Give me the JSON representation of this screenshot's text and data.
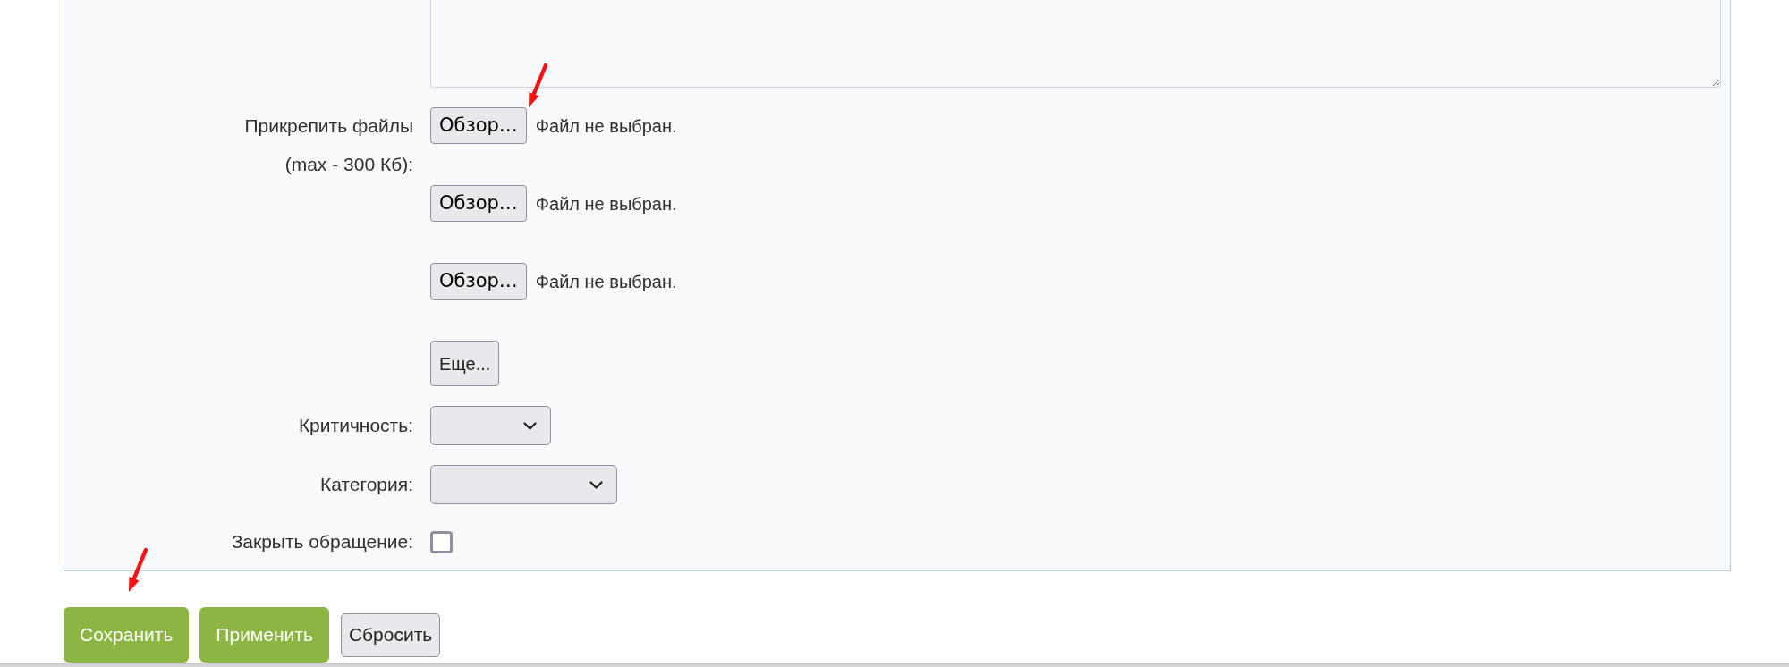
{
  "attachments": {
    "label": "Прикрепить файлы (max - 300 Кб):",
    "files": [
      {
        "button": "Обзор…",
        "status": "Файл не выбран.",
        "pointer_arrow": true
      },
      {
        "button": "Обзор…",
        "status": "Файл не выбран.",
        "pointer_arrow": false
      },
      {
        "button": "Обзор…",
        "status": "Файл не выбран.",
        "pointer_arrow": false
      }
    ],
    "more_button": "Еще..."
  },
  "fields": [
    {
      "kind": "select",
      "label": "Критичность:"
    },
    {
      "kind": "select",
      "label": "Категория:"
    },
    {
      "kind": "checkbox",
      "label": "Закрыть обращение:",
      "checked": false
    }
  ],
  "buttons": [
    {
      "label": "Сохранить",
      "kind": "primary",
      "pointer_arrow": true
    },
    {
      "label": "Применить",
      "kind": "primary",
      "pointer_arrow": false
    },
    {
      "label": "Сбросить",
      "kind": "secondary",
      "pointer_arrow": false
    }
  ]
}
